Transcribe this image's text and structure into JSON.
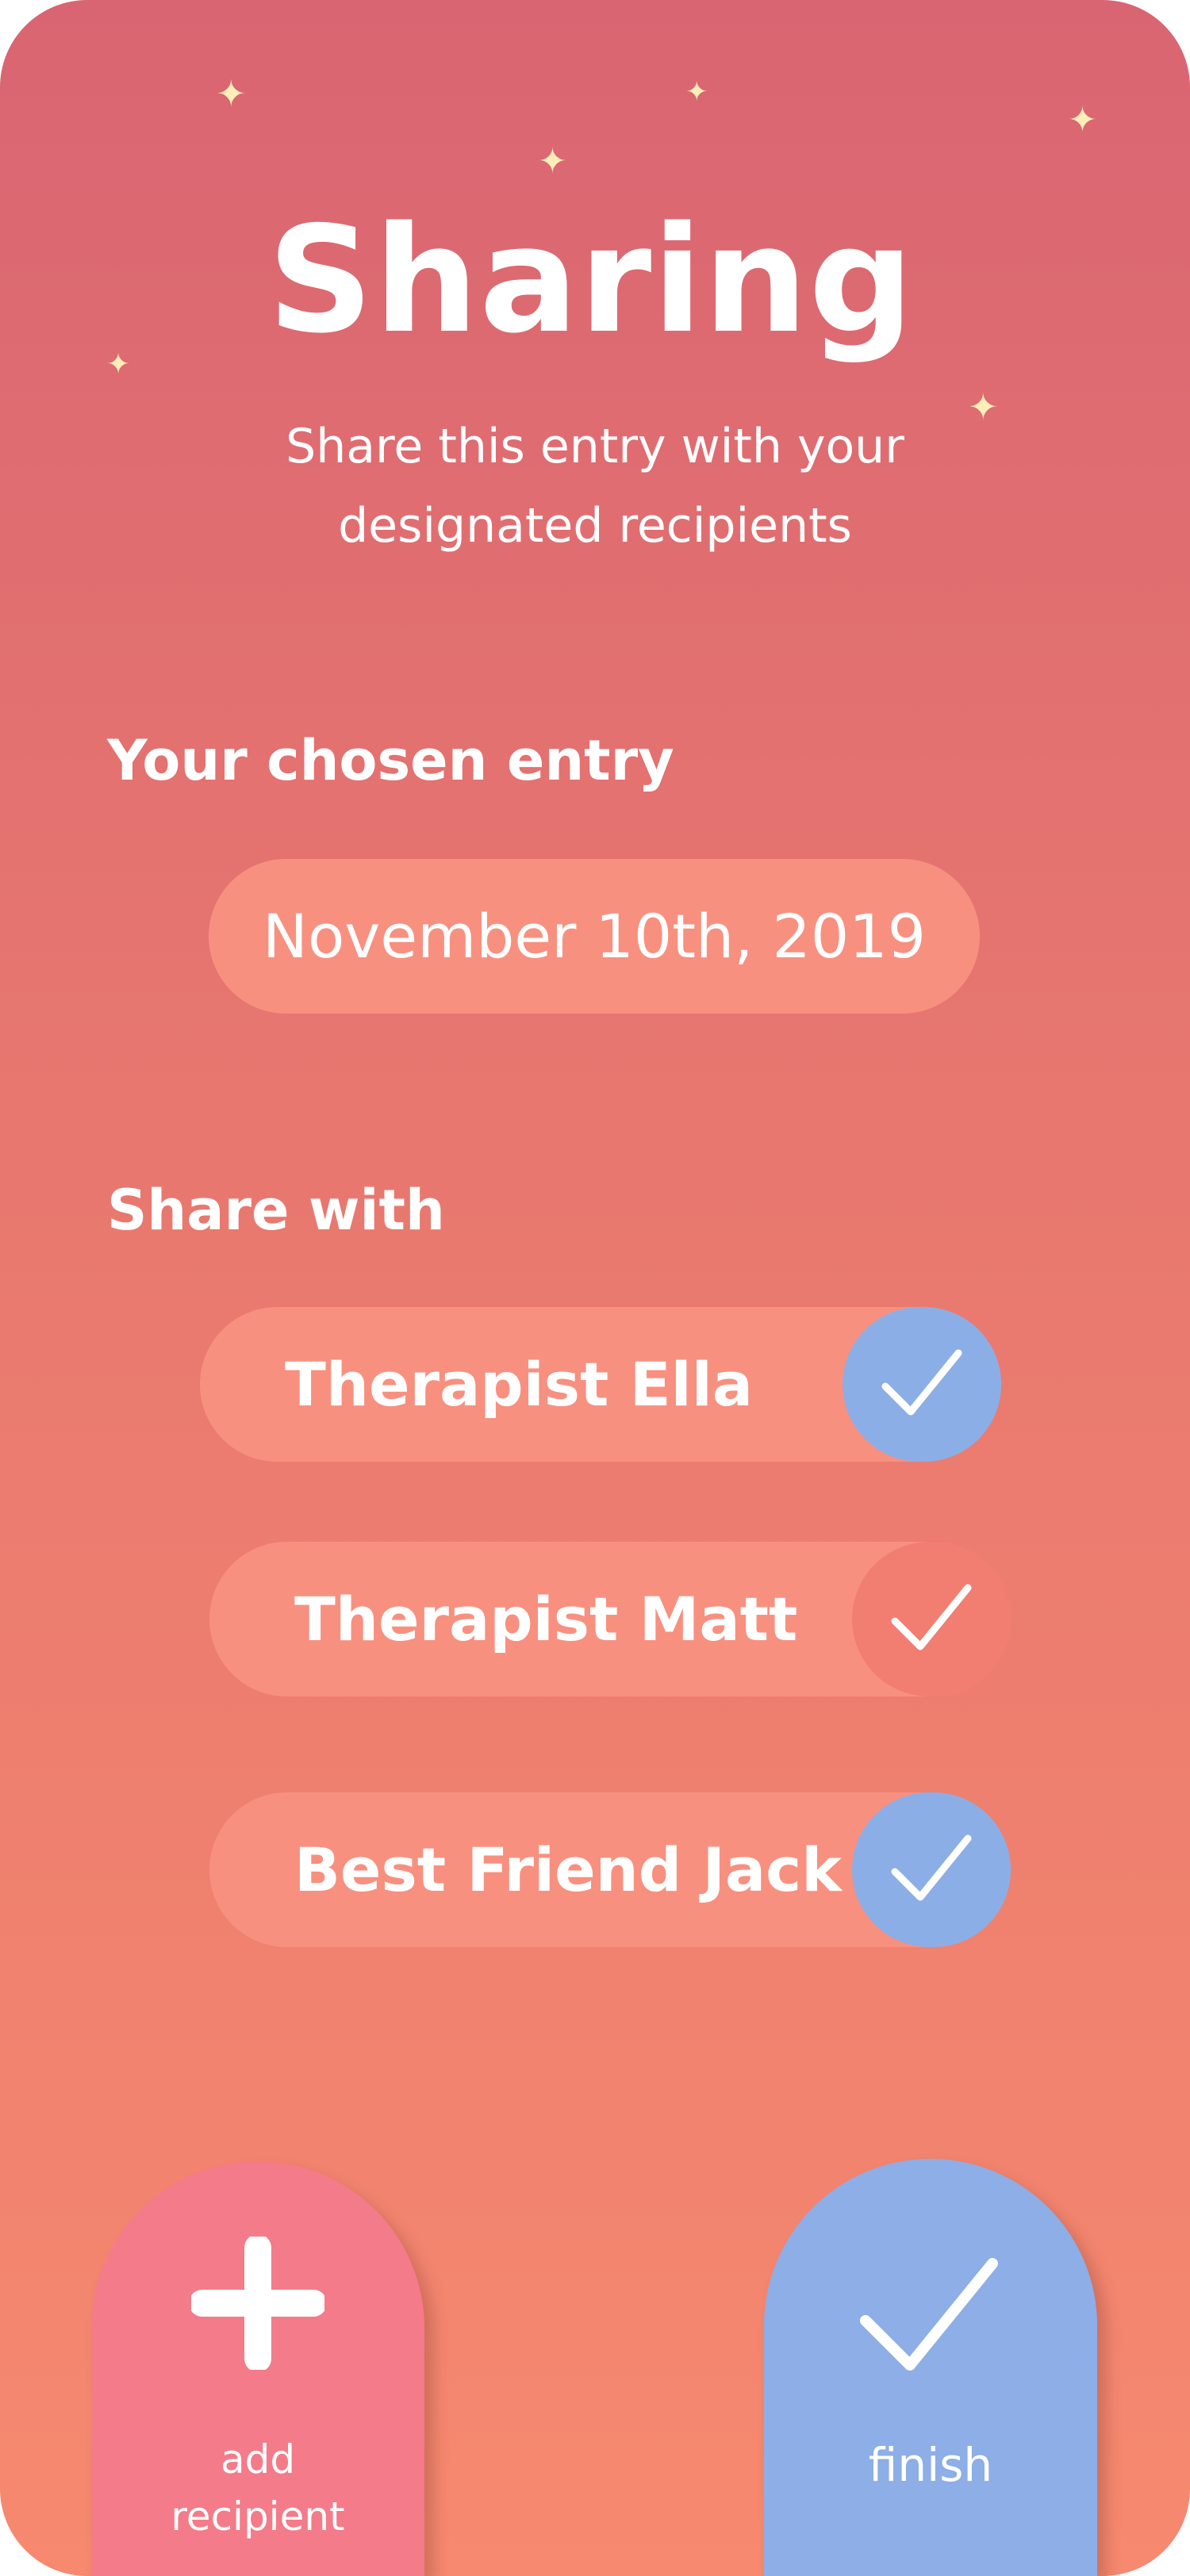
{
  "header": {
    "title": "Sharing",
    "subtitle_line1": "Share this entry with your",
    "subtitle_line2": "designated recipients"
  },
  "entry": {
    "heading": "Your chosen entry",
    "date": "November 10th, 2019"
  },
  "share": {
    "heading": "Share with",
    "recipients": [
      {
        "name": "Therapist Ella",
        "selected": true,
        "check_color": "#8caee6"
      },
      {
        "name": "Therapist Matt",
        "selected": false,
        "check_color": "#f27d71"
      },
      {
        "name": "Best Friend Jack",
        "selected": true,
        "check_color": "#8caee6"
      }
    ]
  },
  "actions": {
    "add_line1": "add",
    "add_line2": "recipient",
    "finish": "finish"
  },
  "colors": {
    "pill_bg": "#f89080",
    "selected_blue": "#8caee6",
    "add_button": "#f47b89",
    "finish_button": "#8daee6",
    "star": "#fbeeb8"
  },
  "icons": [
    "sparkle-star-icon",
    "check-icon",
    "plus-icon"
  ]
}
